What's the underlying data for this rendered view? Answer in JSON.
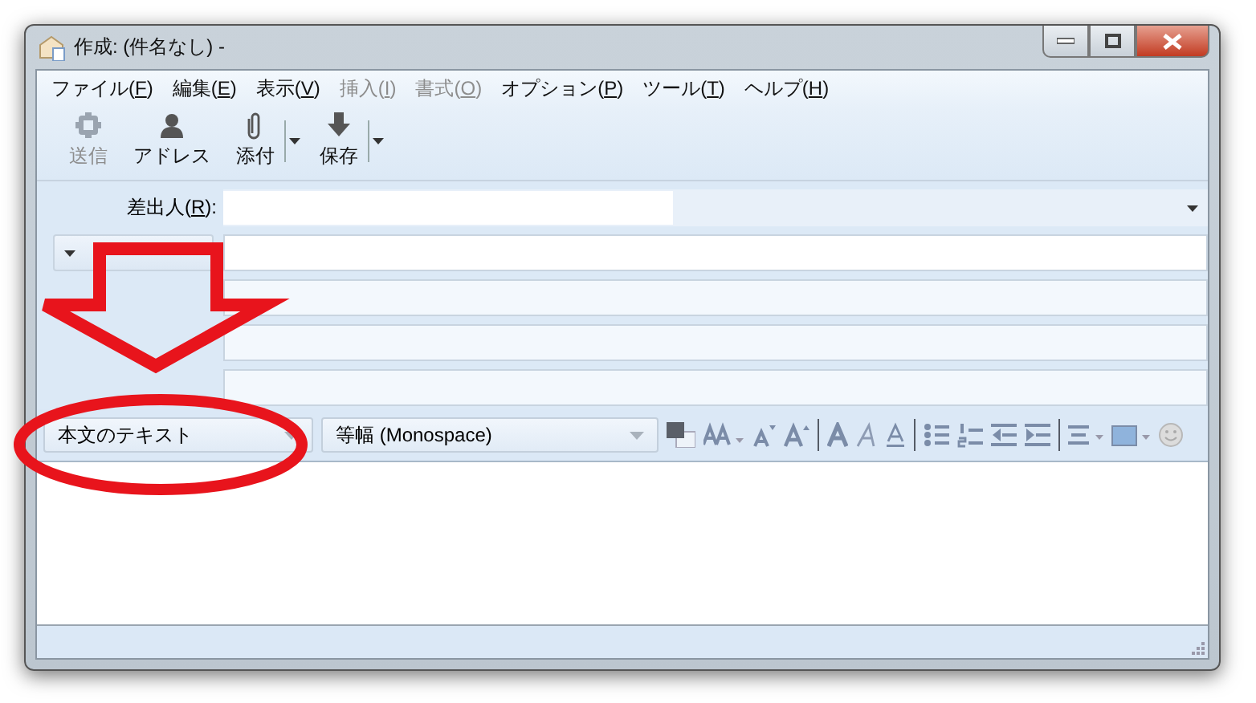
{
  "window": {
    "title": "作成: (件名なし) -"
  },
  "menu": [
    {
      "label": "ファイル(F)",
      "disabled": false
    },
    {
      "label": "編集(E)",
      "disabled": false
    },
    {
      "label": "表示(V)",
      "disabled": false
    },
    {
      "label": "挿入(I)",
      "disabled": true
    },
    {
      "label": "書式(O)",
      "disabled": true
    },
    {
      "label": "オプション(P)",
      "disabled": false
    },
    {
      "label": "ツール(T)",
      "disabled": false
    },
    {
      "label": "ヘルプ(H)",
      "disabled": false
    }
  ],
  "toolbar": [
    {
      "kind": "send",
      "label": "送信",
      "disabled": true,
      "dropdown": false
    },
    {
      "kind": "address",
      "label": "アドレス",
      "disabled": false,
      "dropdown": false
    },
    {
      "kind": "attach",
      "label": "添付",
      "disabled": false,
      "dropdown": true
    },
    {
      "kind": "save",
      "label": "保存",
      "disabled": false,
      "dropdown": true
    }
  ],
  "header": {
    "from_label": "差出人(R):",
    "rows": [
      {
        "kind": "recipient"
      },
      {
        "kind": "blank"
      },
      {
        "kind": "blank"
      },
      {
        "kind": "subject"
      }
    ]
  },
  "format_bar": {
    "paragraph_style": "本文のテキスト",
    "font": "等幅 (Monospace)"
  }
}
